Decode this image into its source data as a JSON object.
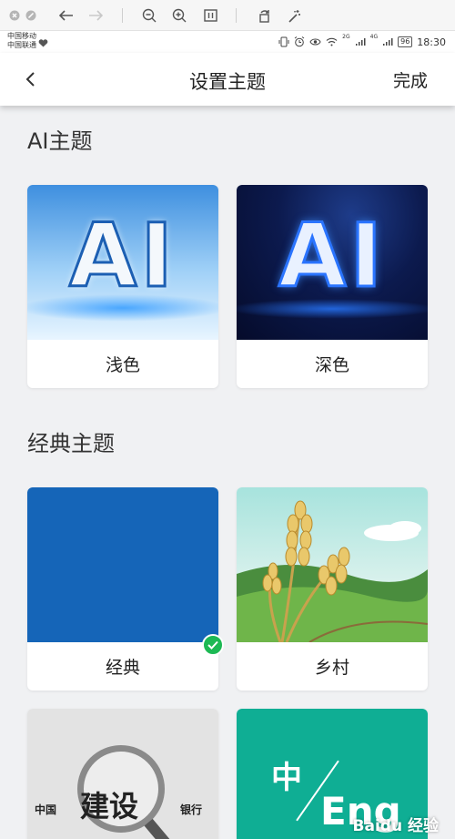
{
  "header": {
    "title": "设置主题",
    "done_label": "完成"
  },
  "status_bar": {
    "carrier1": "中国移动",
    "carrier2": "中国联通",
    "network": "4G",
    "network2": "2G",
    "battery": "96",
    "time": "18:30"
  },
  "sections": [
    {
      "title": "AI主题",
      "cards": [
        {
          "label": "浅色"
        },
        {
          "label": "深色"
        }
      ]
    },
    {
      "title": "经典主题",
      "cards": [
        {
          "label": "经典",
          "selected": true
        },
        {
          "label": "乡村"
        }
      ]
    }
  ],
  "thumbs": {
    "ai_text": "AI",
    "bank": {
      "left": "中国",
      "center": "建设",
      "right": "银行"
    },
    "lang": {
      "left": "中",
      "right": "Eng"
    }
  },
  "watermark": "Baidu 经验",
  "colors": {
    "classic_blue": "#1565b8",
    "check_green": "#1db954",
    "teal": "#0fae94"
  }
}
